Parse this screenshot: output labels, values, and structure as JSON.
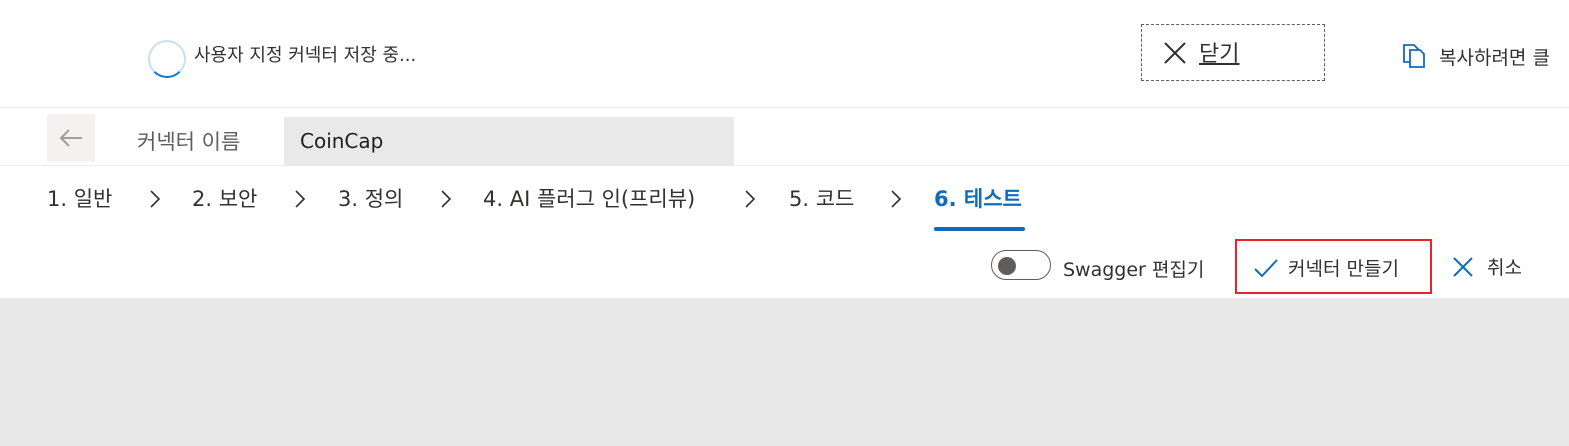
{
  "banner": {
    "status_text": "사용자 지정 커넥터 저장 중...",
    "close_label": "닫기",
    "copy_label": "복사하려면 클"
  },
  "name_row": {
    "label": "커넥터 이름",
    "input_value": "CoinCap"
  },
  "steps": [
    {
      "label": "1. 일반",
      "active": false
    },
    {
      "label": "2. 보안",
      "active": false
    },
    {
      "label": "3. 정의",
      "active": false
    },
    {
      "label": "4. AI 플러그 인(프리뷰)",
      "active": false
    },
    {
      "label": "5. 코드",
      "active": false
    },
    {
      "label": "6. 테스트",
      "active": true
    }
  ],
  "command_bar": {
    "swagger_label": "Swagger 편집기",
    "swagger_on": false,
    "create_label": "커넥터 만들기",
    "cancel_label": "취소"
  },
  "colors": {
    "accent": "#0f6cbd",
    "spinner": "#0078d4",
    "highlight_border": "#e3262e",
    "content_bg": "#e8e8e8"
  }
}
